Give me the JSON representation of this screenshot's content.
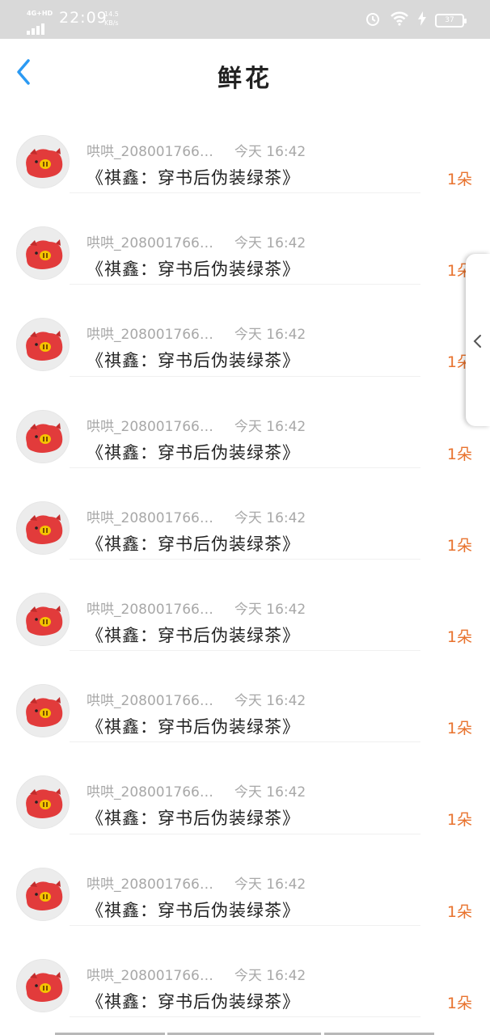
{
  "status_bar": {
    "network": "4G+HD",
    "time": "22:09",
    "speed_value": "14.5",
    "speed_unit": "KB/s",
    "battery": "37"
  },
  "header": {
    "title": "鲜花"
  },
  "items": [
    {
      "user": "哄哄_208001766…",
      "time": "今天 16:42",
      "book": "《祺鑫：穿书后伪装绿茶》",
      "count": "1朵"
    },
    {
      "user": "哄哄_208001766…",
      "time": "今天 16:42",
      "book": "《祺鑫：穿书后伪装绿茶》",
      "count": "1朵"
    },
    {
      "user": "哄哄_208001766…",
      "time": "今天 16:42",
      "book": "《祺鑫：穿书后伪装绿茶》",
      "count": "1朵"
    },
    {
      "user": "哄哄_208001766…",
      "time": "今天 16:42",
      "book": "《祺鑫：穿书后伪装绿茶》",
      "count": "1朵"
    },
    {
      "user": "哄哄_208001766…",
      "time": "今天 16:42",
      "book": "《祺鑫：穿书后伪装绿茶》",
      "count": "1朵"
    },
    {
      "user": "哄哄_208001766…",
      "time": "今天 16:42",
      "book": "《祺鑫：穿书后伪装绿茶》",
      "count": "1朵"
    },
    {
      "user": "哄哄_208001766…",
      "time": "今天 16:42",
      "book": "《祺鑫：穿书后伪装绿茶》",
      "count": "1朵"
    },
    {
      "user": "哄哄_208001766…",
      "time": "今天 16:42",
      "book": "《祺鑫：穿书后伪装绿茶》",
      "count": "1朵"
    },
    {
      "user": "哄哄_208001766…",
      "time": "今天 16:42",
      "book": "《祺鑫：穿书后伪装绿茶》",
      "count": "1朵"
    },
    {
      "user": "哄哄_208001766…",
      "time": "今天 16:42",
      "book": "《祺鑫：穿书后伪装绿茶》",
      "count": "1朵"
    }
  ],
  "icons": {
    "back": "chevron-left-icon",
    "side_tab": "chevron-left-icon",
    "avatar": "red-pig-avatar"
  },
  "colors": {
    "accent_blue": "#2b9af3",
    "flower_orange": "#e8722d",
    "status_bar_bg": "#d9d9d9",
    "avatar_red": "#e23b3b"
  }
}
